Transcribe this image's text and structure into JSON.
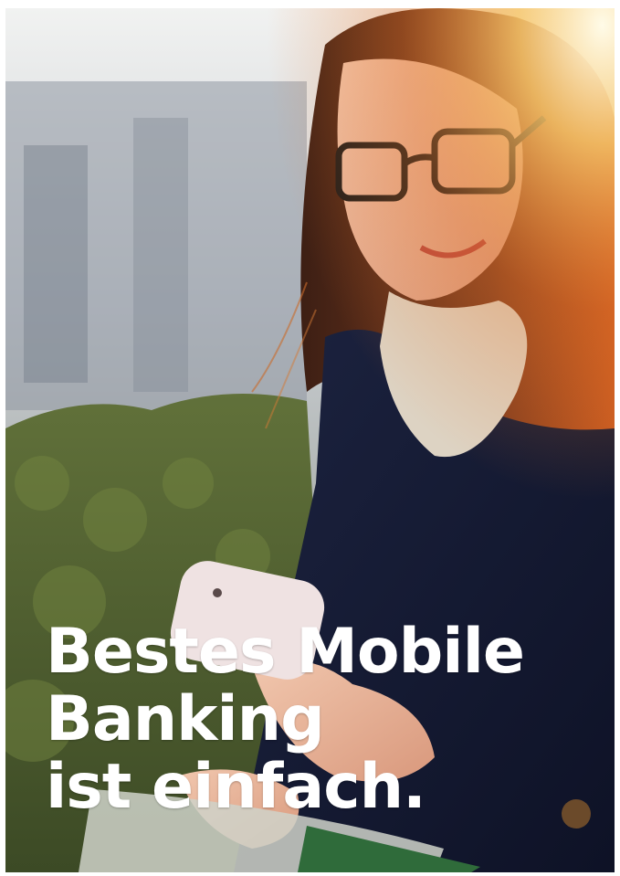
{
  "headline": {
    "line1": "Bestes Mobile",
    "line2": "Banking",
    "line3": "ist einfach."
  },
  "photo": {
    "subject": "woman-with-smartphone-icon",
    "colors": {
      "sky": "#dfe3e6",
      "building": "#8b93a0",
      "hedge": "#53642f",
      "hair": "#6b2f1a",
      "coat": "#141a35",
      "scarf": "#d8cfc0",
      "skin": "#e7b39c",
      "phone": "#ecdedf",
      "sunflare": "#f39a35"
    }
  }
}
